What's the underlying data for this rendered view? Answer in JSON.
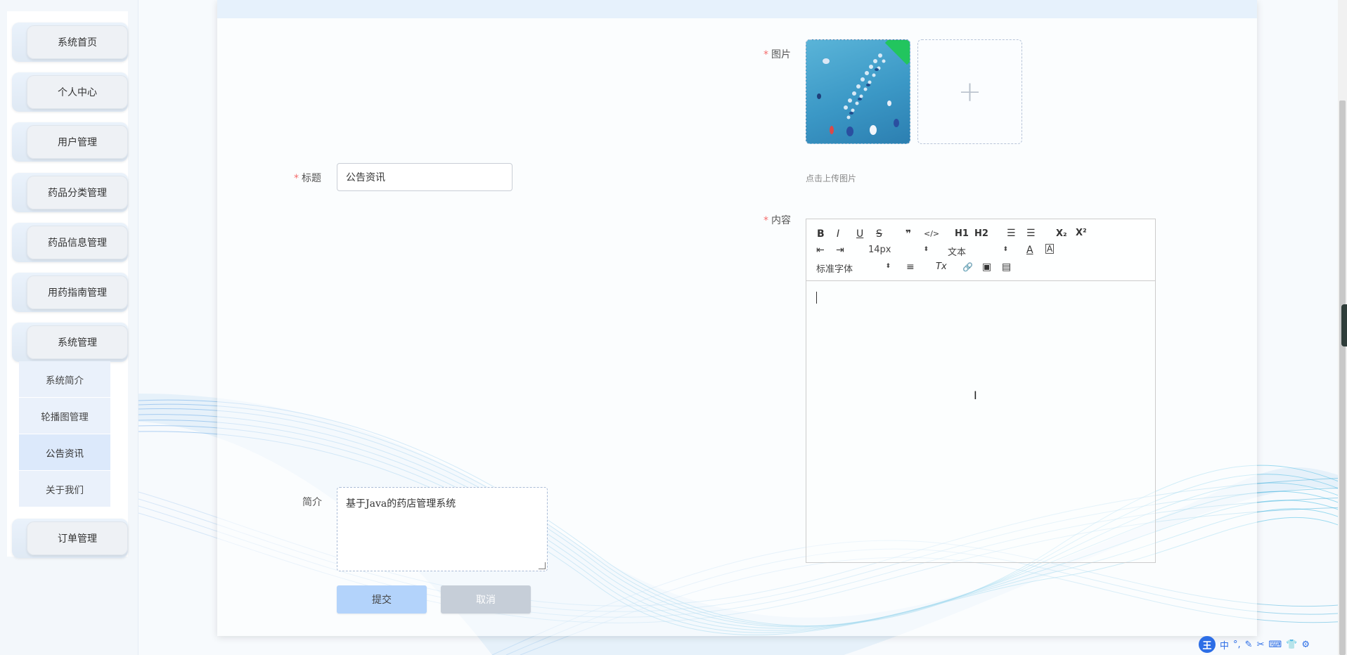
{
  "sidebar": {
    "menu": [
      {
        "label": "系统首页"
      },
      {
        "label": "个人中心"
      },
      {
        "label": "用户管理"
      },
      {
        "label": "药品分类管理"
      },
      {
        "label": "药品信息管理"
      },
      {
        "label": "用药指南管理"
      },
      {
        "label": "系统管理"
      }
    ],
    "submenu": [
      {
        "label": "系统简介"
      },
      {
        "label": "轮播图管理"
      },
      {
        "label": "公告资讯",
        "active": true
      },
      {
        "label": "关于我们"
      }
    ],
    "last": {
      "label": "订单管理"
    }
  },
  "form": {
    "title_label": "标题",
    "title_value": "公告资讯",
    "image_label": "图片",
    "upload_hint": "点击上传图片",
    "content_label": "内容",
    "intro_label": "简介",
    "intro_value": "基于Java的药店管理系统",
    "submit_label": "提交",
    "cancel_label": "取消",
    "required_mark": "*"
  },
  "editor": {
    "font_size": "14px",
    "text_style": "文本",
    "font_family": "标准字体",
    "tools": {
      "bold": "B",
      "italic": "I",
      "underline": "U",
      "strike": "S",
      "quote": "❞",
      "code": "</>",
      "h1": "H1",
      "h2": "H2",
      "ordered_list": "☰",
      "bullet_list": "☰",
      "subscript": "X₂",
      "superscript": "X²",
      "outdent": "⇤",
      "indent": "⇥",
      "font_color": "A",
      "background": "A",
      "align": "≡",
      "clean": "Tx",
      "link": "🔗",
      "image": "▣",
      "video": "▤"
    }
  },
  "ime": {
    "logo": "王",
    "mode": "中"
  },
  "colors": {
    "accent": "#b3d3fb",
    "required": "#f56c6c",
    "card_top": "#e6f1fc"
  }
}
